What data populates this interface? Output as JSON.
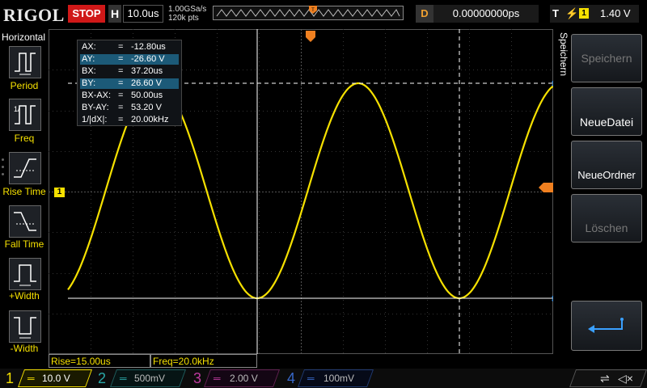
{
  "top_bar": {
    "logo": "RIGOL",
    "run_state": "STOP",
    "timebase_label": "H",
    "timebase_value": "10.0us",
    "sample_rate": "1.00GSa/s",
    "memory_depth": "120k pts",
    "delay_label": "D",
    "delay_value": "0.00000000ps",
    "trigger_label": "T",
    "trigger_source": "1",
    "trigger_level": "1.40 V"
  },
  "left_menu": {
    "title": "Horizontal",
    "items": [
      {
        "label": "Period",
        "icon": "period-icon"
      },
      {
        "label": "Freq",
        "icon": "freq-icon"
      },
      {
        "label": "Rise Time",
        "icon": "rise-time-icon"
      },
      {
        "label": "Fall Time",
        "icon": "fall-time-icon"
      },
      {
        "label": "+Width",
        "icon": "positive-width-icon"
      },
      {
        "label": "-Width",
        "icon": "negative-width-icon"
      }
    ],
    "channel_marker": "1"
  },
  "cursor_readout": [
    {
      "key": "AX:",
      "value": "-12.80us",
      "highlight": false
    },
    {
      "key": "AY:",
      "value": "-26.60 V",
      "highlight": true
    },
    {
      "key": "BX:",
      "value": "37.20us",
      "highlight": false
    },
    {
      "key": "BY:",
      "value": "26.60 V",
      "highlight": true
    },
    {
      "key": "BX-AX:",
      "value": "50.00us",
      "highlight": false
    },
    {
      "key": "BY-AY:",
      "value": "53.20 V",
      "highlight": false
    },
    {
      "key": "1/|dX|:",
      "value": "20.00kHz",
      "highlight": false
    }
  ],
  "right_menu": {
    "title": "Speichern",
    "buttons": [
      {
        "label": "Speichern",
        "enabled": false
      },
      {
        "label": "NeueDatei",
        "enabled": true
      },
      {
        "label": "NeueOrdner",
        "enabled": true
      },
      {
        "label": "Löschen",
        "enabled": false
      }
    ],
    "return_icon": "return-arrow-icon"
  },
  "measurements": {
    "rise": "Rise=15.00us",
    "freq": "Freq=20.0kHz"
  },
  "channels": [
    {
      "num": "1",
      "scale": "10.0 V",
      "color": "#f5e000",
      "active": true
    },
    {
      "num": "2",
      "scale": "500mV",
      "color": "#2aa8a8",
      "active": false
    },
    {
      "num": "3",
      "scale": "2.00 V",
      "color": "#c03aa0",
      "active": false
    },
    {
      "num": "4",
      "scale": "100mV",
      "color": "#3868c8",
      "active": false
    }
  ],
  "status_icons": [
    "usb-icon",
    "speaker-muted-icon"
  ],
  "colors": {
    "ch1": "#f5e000",
    "run_stop": "#d01818",
    "trigger_marker": "#f08020",
    "selection": "#1c5a78"
  }
}
